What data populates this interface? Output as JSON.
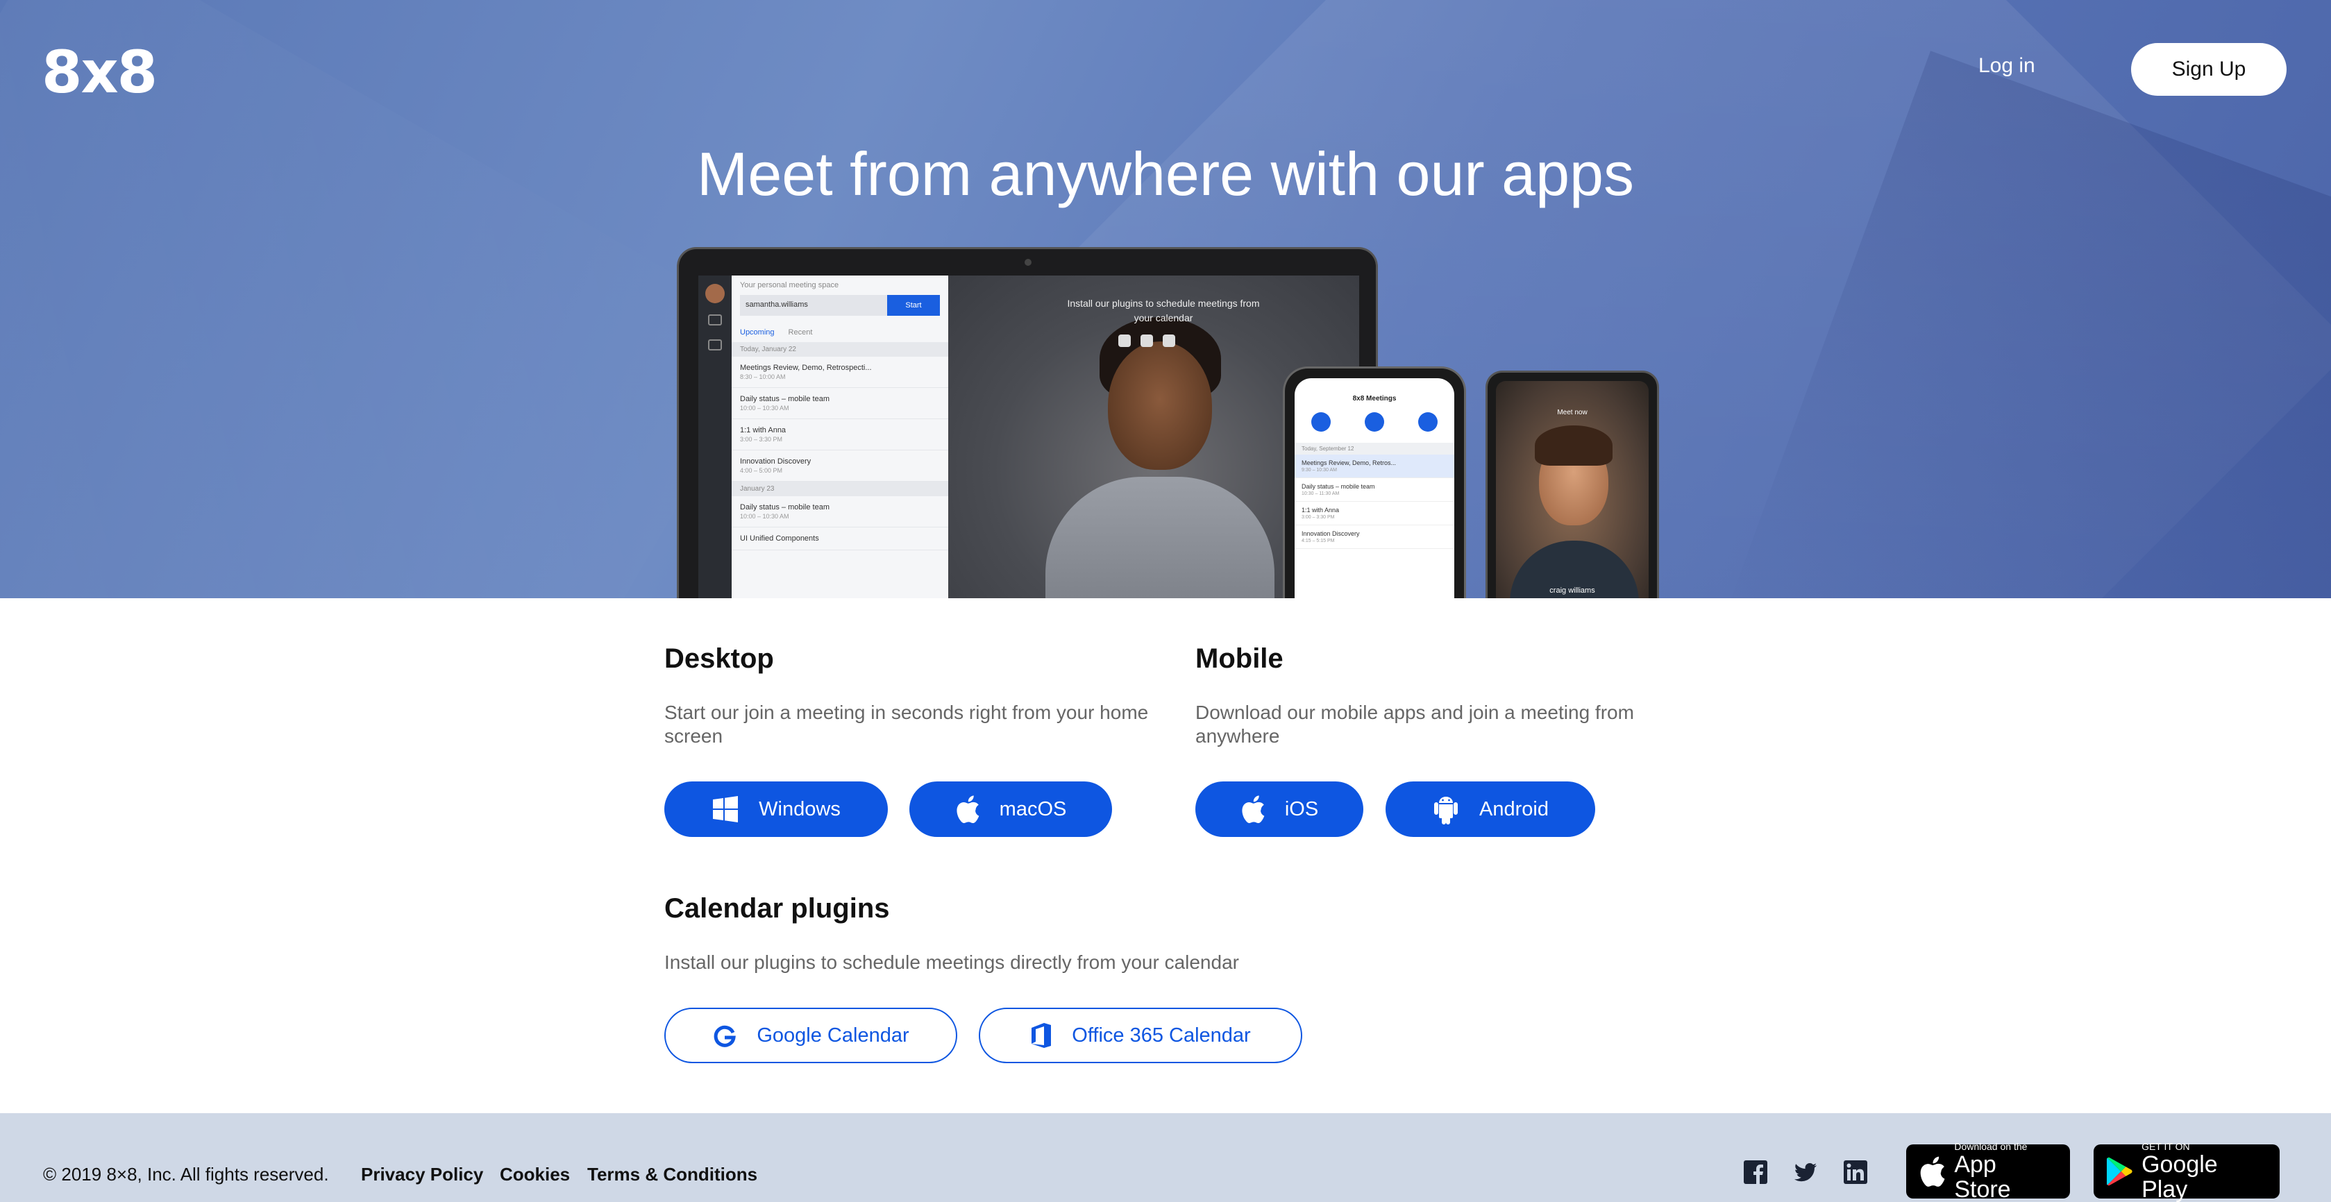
{
  "header": {
    "logo": "8x8",
    "login_label": "Log in",
    "signup_label": "Sign Up"
  },
  "hero": {
    "title": "Meet from anywhere with our apps"
  },
  "mockup": {
    "laptop": {
      "panel_heading": "Your personal meeting space",
      "meeting_id": "samantha.williams",
      "start_label": "Start",
      "tabs": [
        "Upcoming",
        "Recent"
      ],
      "day1": "Today, January 22",
      "day2": "January 23",
      "meetings": [
        {
          "title": "Meetings Review, Demo, Retrospecti...",
          "time": "8:30 – 10:00 AM"
        },
        {
          "title": "Daily status – mobile team",
          "time": "10:00 – 10:30 AM"
        },
        {
          "title": "1:1 with Anna",
          "time": "3:00 – 3:30 PM"
        },
        {
          "title": "Innovation Discovery",
          "time": "4:00 – 5:00 PM"
        }
      ],
      "meetings_day2": [
        {
          "title": "Daily status – mobile team",
          "time": "10:00 – 10:30 AM"
        },
        {
          "title": "UI Unified Components",
          "time": ""
        }
      ],
      "video_text": "Install our plugins to schedule meetings from your calendar"
    },
    "phone1": {
      "title": "8x8 Meetings",
      "day": "Today, September 12",
      "rows": [
        {
          "title": "Meetings Review, Demo, Retros...",
          "time": "9:30 – 10:30 AM"
        },
        {
          "title": "Daily status – mobile team",
          "time": "10:30 – 11:30 AM"
        },
        {
          "title": "1:1 with Anna",
          "time": "3:00 – 3:30 PM"
        },
        {
          "title": "Innovation Discovery",
          "time": "4:15 – 5:15 PM"
        }
      ]
    },
    "phone2": {
      "title": "Meet now",
      "name": "craig williams"
    }
  },
  "desktop": {
    "heading": "Desktop",
    "description": "Start our join a meeting in seconds right from your home screen",
    "windows_label": "Windows",
    "macos_label": "macOS"
  },
  "mobile": {
    "heading": "Mobile",
    "description": "Download our mobile apps and join a meeting from anywhere",
    "ios_label": "iOS",
    "android_label": "Android"
  },
  "plugins": {
    "heading": "Calendar plugins",
    "description": "Install our plugins to schedule meetings directly from your calendar",
    "google_label": "Google Calendar",
    "office_label": "Office 365 Calendar"
  },
  "footer": {
    "copyright": "© 2019 8×8, Inc. All fights reserved.",
    "privacy": "Privacy Policy",
    "cookies": "Cookies",
    "terms": "Terms & Conditions",
    "appstore_small": "Download on the",
    "appstore_big": "App Store",
    "googleplay_small": "GET IT ON",
    "googleplay_big": "Google Play"
  },
  "colors": {
    "accent": "#0e56e1",
    "footer_bg": "#cfd8e6",
    "hero_bg": "#5b77b8"
  }
}
